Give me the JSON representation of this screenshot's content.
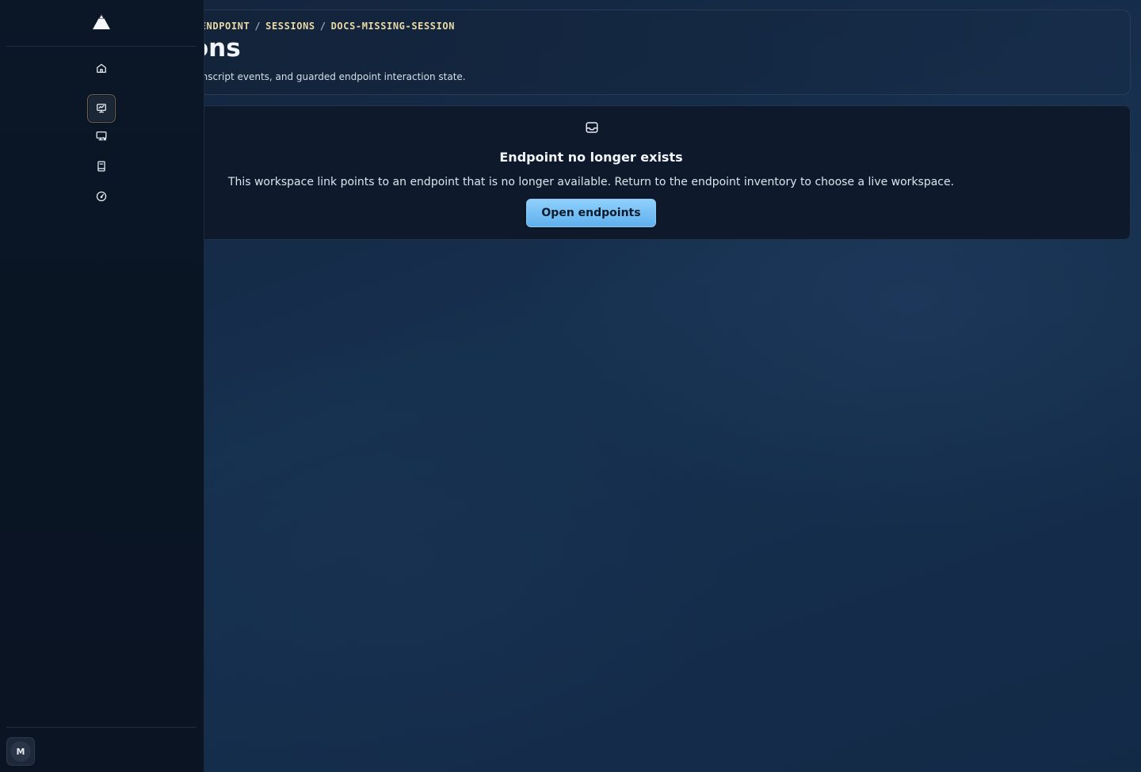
{
  "sidebar": {
    "logo_icon": "mountain-logo-icon",
    "nav_items": [
      {
        "name": "home",
        "icon": "home-icon",
        "active": false
      },
      {
        "name": "sessions",
        "icon": "presentation-monitor-icon",
        "active": true
      },
      {
        "name": "endpoints",
        "icon": "monitor-remote-icon",
        "active": false
      },
      {
        "name": "docs",
        "icon": "book-icon",
        "active": false
      },
      {
        "name": "dashboard",
        "icon": "gauge-icon",
        "active": false
      }
    ],
    "user_initial": "M"
  },
  "header": {
    "breadcrumb": [
      "DOCS-MISSING-ENDPOINT",
      "SESSIONS",
      "DOCS-MISSING-SESSION"
    ],
    "breadcrumb_separator": "/",
    "title": "Sessions",
    "subtitle": "Live sessions, transcript events, and guarded endpoint interaction state."
  },
  "empty_state": {
    "icon": "inbox-icon",
    "title": "Endpoint no longer exists",
    "description": "This workspace link points to an endpoint that is no longer available. Return to the endpoint inventory to choose a live workspace.",
    "button_label": "Open endpoints"
  },
  "colors": {
    "accent": "#7cc2f7",
    "breadcrumb": "#e9d9a6",
    "background": "#16304f",
    "sidebar": "#0b1626"
  }
}
